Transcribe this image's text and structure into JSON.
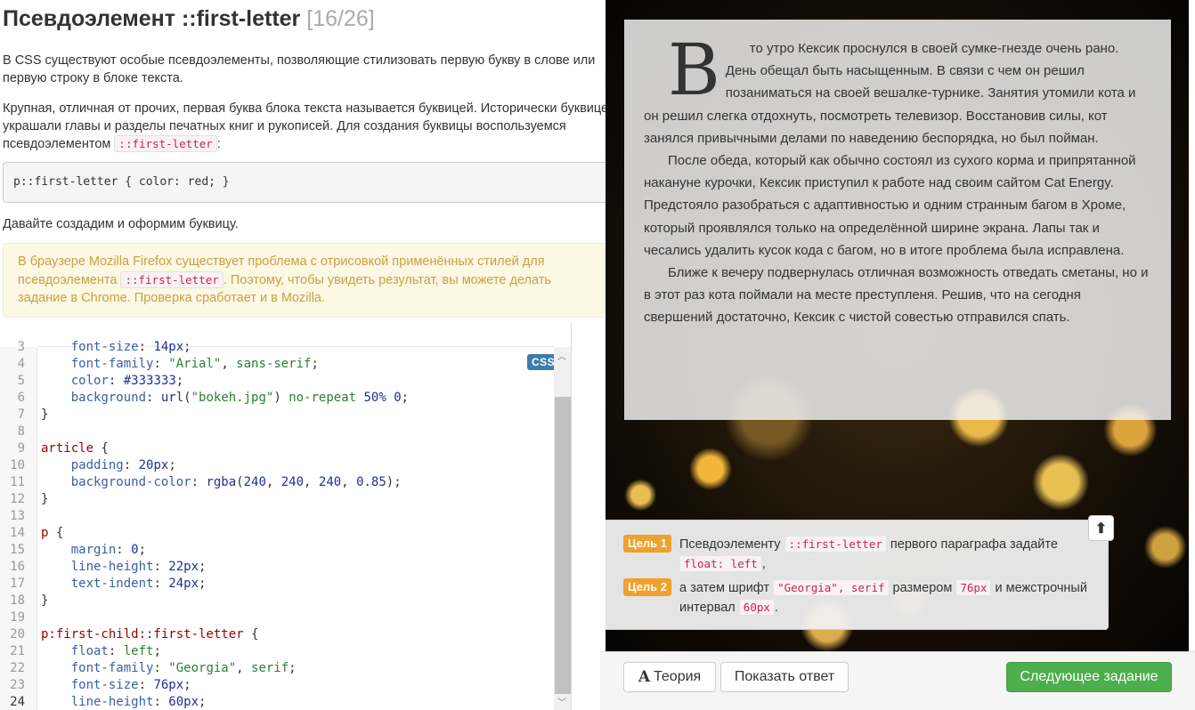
{
  "theory": {
    "title": "Псевдоэлемент ::first-letter",
    "counter": "[16/26]",
    "p1": "В CSS существуют особые псевдоэлементы, позволяющие стилизовать первую букву в слове или первую строку в блоке текста.",
    "p2_before": "Крупная, отличная от прочих, первая буква блока текста называется буквицей. Исторически буквицей украшали главы и разделы печатных книг и рукописей. Для создания буквицы воспользуемся псевдоэлементом ",
    "p2_code": "::first-letter",
    "p2_after": ":",
    "code_example": "p::first-letter { color: red; }",
    "p3": "Давайте создадим и оформим буквицу.",
    "alert_before": "В браузере Mozilla Firefox существует проблема с отрисовкой применённых стилей для псевдоэлемента ",
    "alert_code": "::first-letter",
    "alert_after": ". Поэтому, чтобы увидеть результат, вы можете делать задание в Chrome. Проверка сработает и в Mozilla."
  },
  "editor": {
    "badge": "CSS",
    "lines": [
      {
        "n": "3",
        "t": "    font-size: 14px;"
      },
      {
        "n": "4",
        "t": "    font-family: \"Arial\", sans-serif;"
      },
      {
        "n": "5",
        "t": "    color: #333333;"
      },
      {
        "n": "6",
        "t": "    background: url(\"bokeh.jpg\") no-repeat 50% 0;"
      },
      {
        "n": "7",
        "t": "}"
      },
      {
        "n": "8",
        "t": ""
      },
      {
        "n": "9",
        "t": "article {"
      },
      {
        "n": "10",
        "t": "    padding: 20px;"
      },
      {
        "n": "11",
        "t": "    background-color: rgba(240, 240, 240, 0.85);"
      },
      {
        "n": "12",
        "t": "}"
      },
      {
        "n": "13",
        "t": ""
      },
      {
        "n": "14",
        "t": "p {"
      },
      {
        "n": "15",
        "t": "    margin: 0;"
      },
      {
        "n": "16",
        "t": "    line-height: 22px;"
      },
      {
        "n": "17",
        "t": "    text-indent: 24px;"
      },
      {
        "n": "18",
        "t": "}"
      },
      {
        "n": "19",
        "t": ""
      },
      {
        "n": "20",
        "t": "p:first-child::first-letter {"
      },
      {
        "n": "21",
        "t": "    float: left;"
      },
      {
        "n": "22",
        "t": "    font-family: \"Georgia\", serif;"
      },
      {
        "n": "23",
        "t": "    font-size: 76px;"
      },
      {
        "n": "24",
        "t": "    line-height: 60px;"
      }
    ]
  },
  "preview": {
    "dropcap": "В",
    "p1_rest": "то утро Кексик проснулся в своей сумке-гнезде очень рано. День обещал быть насыщенным. В связи с чем он решил позаниматься на своей вешалке-турнике. Занятия утомили кота и он решил слегка отдохнуть, посмотреть телевизор. Восстановив силы, кот занялся привычными делами по наведению беспорядка, но был пойман.",
    "p2": "После обеда, который как обычно состоял из сухого корма и припрятанной накануне курочки, Кексик приступил к работе над своим сайтом Cat Energy. Предстояло разобраться с адаптивностью и одним странным багом в Хроме, который проявлялся только на определённой ширине экрана. Лапы так и чесались удалить кусок кода с багом, но в итоге проблема была исправлена.",
    "p3": "Ближе к вечеру подвернулась отличная возможность отведать сметаны, но и в этот раз кота поймали на месте преступленя. Решив, что на сегодня свершений достаточно, Кексик с чистой совестью отправился спать."
  },
  "goals": {
    "g1_label": "Цель 1",
    "g1_a": "Псевдоэлементу ",
    "g1_code1": "::first-letter",
    "g1_b": " первого параграфа задайте ",
    "g1_code2": "float: left",
    "g1_c": ",",
    "g2_label": "Цель 2",
    "g2_a": "а затем шрифт ",
    "g2_code1": "\"Georgia\", serif",
    "g2_b": " размером ",
    "g2_code2": "76px",
    "g2_c": " и межстрочный интервал ",
    "g2_code3": "60px",
    "g2_d": ".",
    "toggle_icon": "arrow-up-icon"
  },
  "buttons": {
    "theory_icon": "A",
    "theory": "Теория",
    "answer": "Показать ответ",
    "next": "Следующее задание"
  },
  "colors": {
    "goal_label": "#f0a02c",
    "next_button": "#4cae4c",
    "css_badge": "#3b7dab"
  }
}
